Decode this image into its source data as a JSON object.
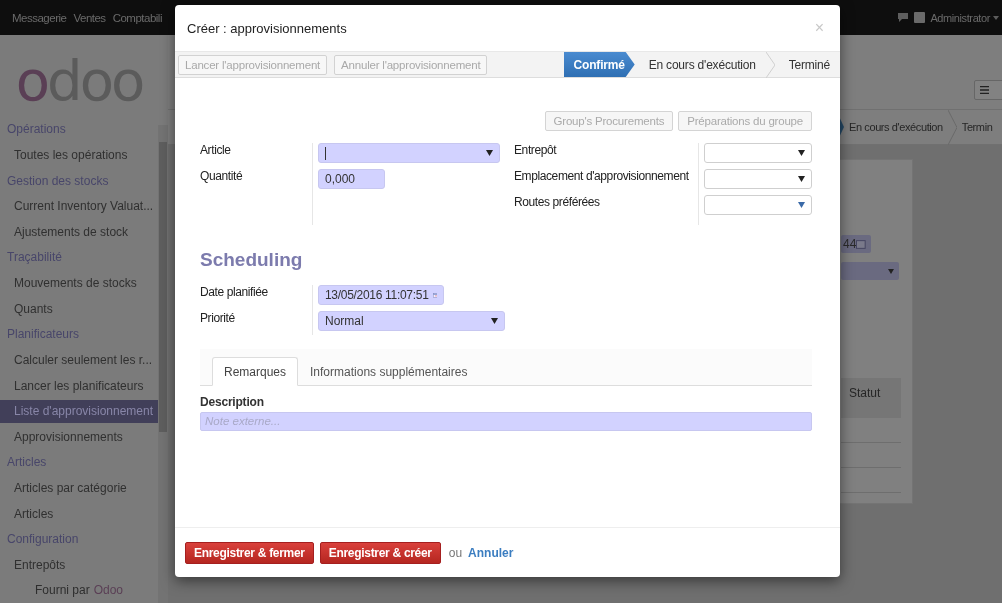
{
  "topbar": {
    "menu": [
      "Messagerie",
      "Ventes",
      "Comptabili"
    ],
    "user": "Administrator"
  },
  "logo": "odoo",
  "sidebar": {
    "sections": [
      {
        "title": "Opérations",
        "items": [
          {
            "label": "Toutes les opérations",
            "selected": false
          }
        ]
      },
      {
        "title": "Gestion des stocks",
        "items": [
          {
            "label": "Current Inventory Valuat...",
            "selected": false
          },
          {
            "label": "Ajustements de stock",
            "selected": false
          }
        ]
      },
      {
        "title": "Traçabilité",
        "items": [
          {
            "label": "Mouvements de stocks",
            "selected": false
          },
          {
            "label": "Quants",
            "selected": false
          }
        ]
      },
      {
        "title": "Planificateurs",
        "items": [
          {
            "label": "Calculer seulement les r...",
            "selected": false
          },
          {
            "label": "Lancer les planificateurs",
            "selected": false
          },
          {
            "label": "Liste d'approvisionnement",
            "selected": true
          },
          {
            "label": "Approvisionnements",
            "selected": false
          }
        ]
      },
      {
        "title": "Articles",
        "items": [
          {
            "label": "Articles par catégorie",
            "selected": false
          },
          {
            "label": "Articles",
            "selected": false
          }
        ]
      },
      {
        "title": "Configuration",
        "items": [
          {
            "label": "Entrepôts",
            "selected": false
          }
        ]
      }
    ],
    "footer": {
      "text": "Fourni par",
      "link": "Odoo"
    }
  },
  "background": {
    "statusbar": [
      {
        "label": "En cours d'exécution",
        "selected": false
      },
      {
        "label": "Termin",
        "selected": false
      }
    ],
    "date_fragment": "44",
    "table_header": "Statut"
  },
  "dialog": {
    "title": "Créer : approvisionnements",
    "close": "×",
    "actions": [
      {
        "label": "Lancer l'approvisionnement",
        "disabled": true
      },
      {
        "label": "Annuler l'approvisionnement",
        "disabled": true
      }
    ],
    "statusbar": [
      {
        "label": "Confirmé",
        "selected": true
      },
      {
        "label": "En cours d'exécution",
        "selected": false
      },
      {
        "label": "Terminé",
        "selected": false
      }
    ],
    "smart_buttons": [
      {
        "label": "Group's Procurements",
        "disabled": true
      },
      {
        "label": "Préparations du groupe",
        "disabled": true
      }
    ],
    "left_fields": [
      {
        "label": "Article",
        "kind": "select",
        "required": true,
        "focused": true
      },
      {
        "label": "Quantité",
        "kind": "number",
        "value": "0,000",
        "required": true
      }
    ],
    "right_fields": [
      {
        "label": "Entrepôt",
        "kind": "select",
        "required": false
      },
      {
        "label": "Emplacement d'approvisionnement",
        "kind": "select",
        "required": false
      },
      {
        "label": "Routes préférées",
        "kind": "tags",
        "required": false
      }
    ],
    "section_title": "Scheduling",
    "schedule_fields": [
      {
        "label": "Date planifiée",
        "kind": "datetime",
        "value": "13/05/2016 11:07:51",
        "required": true
      },
      {
        "label": "Priorité",
        "kind": "select",
        "value": "Normal",
        "required": true
      }
    ],
    "tabs": [
      {
        "label": "Remarques",
        "selected": true
      },
      {
        "label": "Informations supplémentaires",
        "selected": false
      }
    ],
    "description": {
      "label": "Description",
      "placeholder": "Note externe...",
      "required": true
    },
    "footer": {
      "buttons": [
        "Enregistrer & fermer",
        "Enregistrer & créer"
      ],
      "separator": "ou",
      "cancel": "Annuler"
    }
  }
}
